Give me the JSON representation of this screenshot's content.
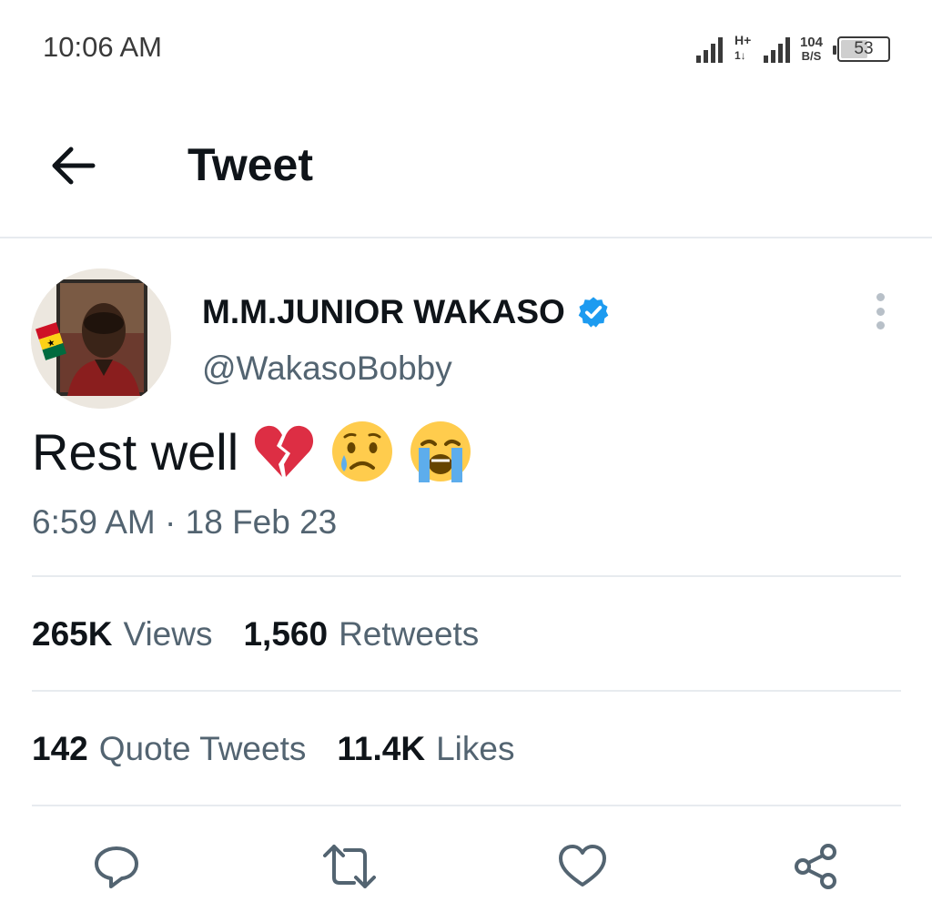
{
  "status_bar": {
    "time": "10:06 AM",
    "network_type": "H+",
    "network_sub": "1↓",
    "speed_value": "104",
    "speed_unit": "B/S",
    "battery_level": "53",
    "battery_fraction": 0.53
  },
  "header": {
    "title": "Tweet",
    "back_icon": "arrow-left-icon"
  },
  "author": {
    "name": "M.M.JUNIOR WAKASO",
    "handle": "@WakasoBobby",
    "verified": true,
    "verified_color": "#1d9bf0"
  },
  "tweet": {
    "text": "Rest well",
    "emojis": [
      "broken-heart-emoji",
      "crying-face-emoji",
      "loudly-crying-face-emoji"
    ],
    "timestamp": "6:59 AM · 18 Feb 23"
  },
  "stats": {
    "views_count": "265K",
    "views_label": "Views",
    "retweets_count": "1,560",
    "retweets_label": "Retweets",
    "quotes_count": "142",
    "quotes_label": "Quote Tweets",
    "likes_count": "11.4K",
    "likes_label": "Likes"
  },
  "actions": [
    "reply-icon",
    "retweet-icon",
    "like-icon",
    "share-icon"
  ],
  "colors": {
    "text_primary": "#0f1419",
    "text_secondary": "#536471",
    "divider": "#e7ebef",
    "icon": "#536471"
  }
}
